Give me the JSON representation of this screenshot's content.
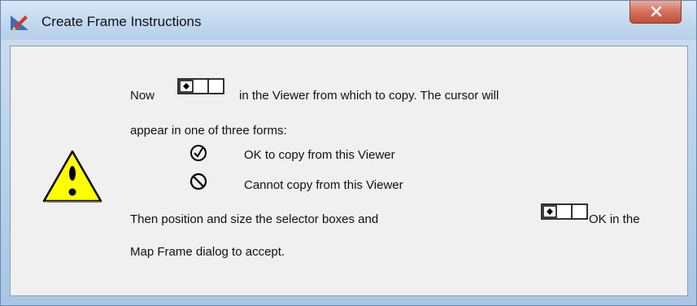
{
  "window": {
    "title": "Create Frame Instructions"
  },
  "icons": {
    "app": "pencil-ruler-icon",
    "close": "close-icon",
    "warning": "warning-icon",
    "mouse": "mouse-left-button-icon",
    "ok_cursor": "check-circle-icon",
    "no_cursor": "prohibited-icon"
  },
  "instructions": {
    "line1_before": "Now",
    "line1_after": "in the Viewer from which to copy. The cursor will",
    "line2": "appear in one of three forms:",
    "ok_text": "OK to copy from this Viewer",
    "no_text": "Cannot copy from this Viewer",
    "line5_before": "Then position and size the selector boxes and",
    "line5_after": "OK in the",
    "line6": "Map Frame dialog to accept."
  },
  "colors": {
    "close_button": "#c9553f",
    "warning_fill": "#ffff00"
  }
}
